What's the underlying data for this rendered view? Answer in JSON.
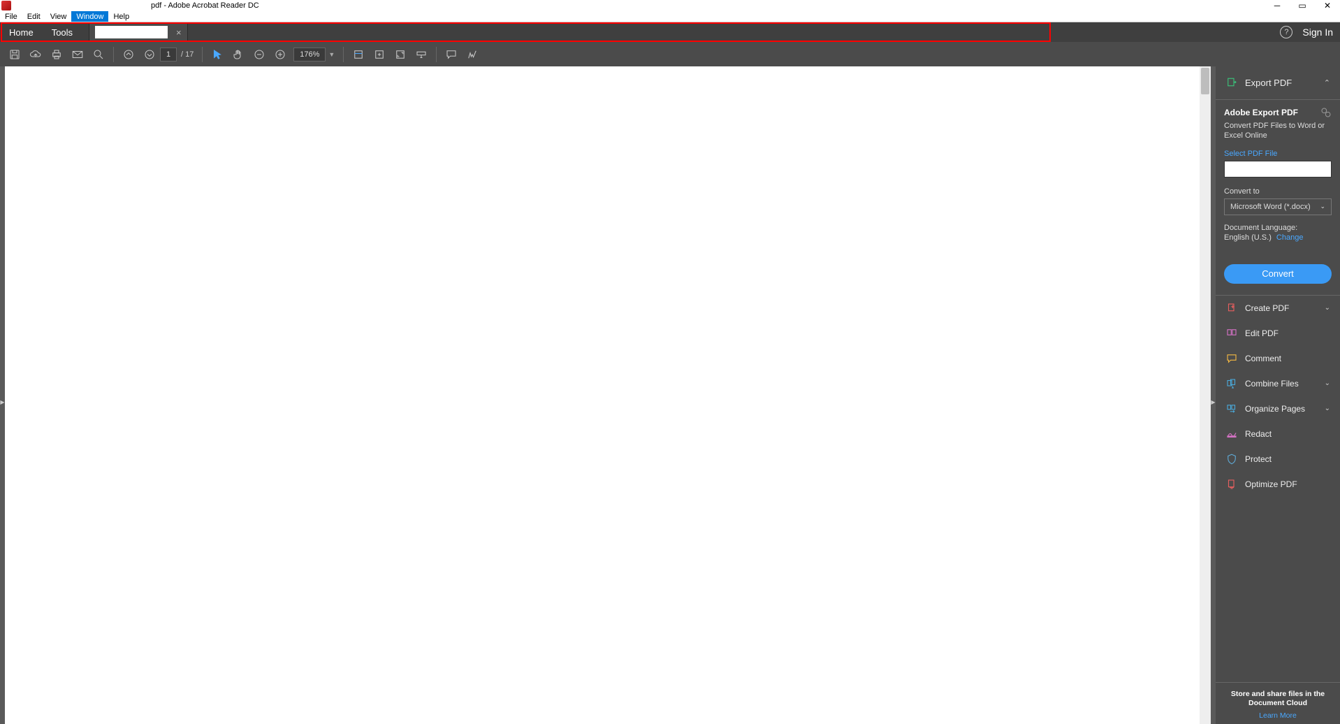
{
  "titlebar": {
    "title": "pdf - Adobe Acrobat Reader DC"
  },
  "menubar": {
    "items": [
      "File",
      "Edit",
      "View",
      "Window",
      "Help"
    ],
    "active_index": 3
  },
  "tabstrip": {
    "home": "Home",
    "tools": "Tools",
    "doc_tab": "",
    "signin": "Sign In"
  },
  "toolbar": {
    "page_current": "1",
    "page_total": "/ 17",
    "zoom": "176%"
  },
  "rpanel": {
    "export": {
      "head": "Export PDF",
      "subtitle": "Adobe Export PDF",
      "desc": "Convert PDF Files to Word or Excel Online",
      "select_label": "Select PDF File",
      "convert_label": "Convert to",
      "convert_option": "Microsoft Word (*.docx)",
      "lang_label": "Document Language:",
      "lang_value": "English (U.S.)",
      "lang_change": "Change",
      "convert_btn": "Convert"
    },
    "tools": [
      {
        "label": "Create PDF",
        "color": "#e85f5f",
        "caret": true
      },
      {
        "label": "Edit PDF",
        "color": "#d472c4",
        "caret": false
      },
      {
        "label": "Comment",
        "color": "#f5b942",
        "caret": false
      },
      {
        "label": "Combine Files",
        "color": "#4aa8d8",
        "caret": true
      },
      {
        "label": "Organize Pages",
        "color": "#4aa8d8",
        "caret": true
      },
      {
        "label": "Redact",
        "color": "#d472c4",
        "caret": false
      },
      {
        "label": "Protect",
        "color": "#5faad6",
        "caret": false
      },
      {
        "label": "Optimize PDF",
        "color": "#e85f5f",
        "caret": false
      }
    ],
    "footer": {
      "text": "Store and share files in the Document Cloud",
      "link": "Learn More"
    }
  }
}
